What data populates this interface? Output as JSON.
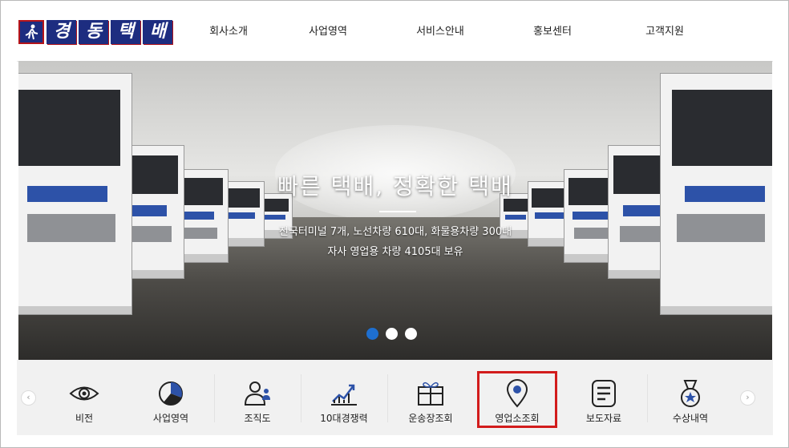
{
  "brand": {
    "logo_chars": [
      "경",
      "동",
      "택",
      "배"
    ],
    "colors": {
      "navy": "#1d2d80",
      "red": "#b4141a"
    }
  },
  "nav": {
    "items": [
      "회사소개",
      "사업영역",
      "서비스안내",
      "홍보센터",
      "고객지원"
    ]
  },
  "hero": {
    "title": "빠른 택배, 정확한 택배",
    "line1": "전국터미널 7개, 노선차량 610대, 화물용차량 300대",
    "line2": "자사 영업용 차량 4105대 보유",
    "slides": 3,
    "active_slide": 1,
    "dot_active_color": "#1e6fd0"
  },
  "quick_menu": {
    "items": [
      {
        "label": "비전",
        "icon": "eye-icon"
      },
      {
        "label": "사업영역",
        "icon": "pie-chart-icon"
      },
      {
        "label": "조직도",
        "icon": "org-people-icon"
      },
      {
        "label": "10대경쟁력",
        "icon": "growth-chart-icon"
      },
      {
        "label": "운송장조회",
        "icon": "gift-box-icon"
      },
      {
        "label": "영업소조회",
        "icon": "map-pin-icon"
      },
      {
        "label": "보도자료",
        "icon": "document-list-icon"
      },
      {
        "label": "수상내역",
        "icon": "medal-icon"
      }
    ],
    "highlighted": "영업소조회",
    "highlight_color": "#d21c1c",
    "prev_arrow": "‹",
    "next_arrow": "›"
  }
}
